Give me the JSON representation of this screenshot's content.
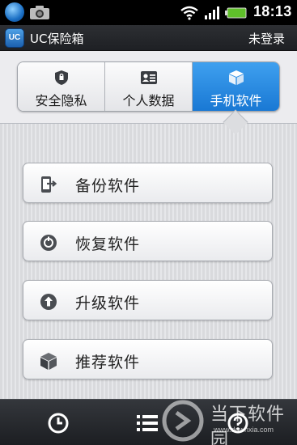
{
  "status_bar": {
    "time": "18:13",
    "icons": [
      "app-badge-icon",
      "camera-icon",
      "wifi-icon",
      "signal-icon",
      "battery-icon"
    ]
  },
  "title_bar": {
    "logo_text": "UC",
    "title": "UC保险箱",
    "login_label": "未登录"
  },
  "tabs": [
    {
      "label": "安全隐私",
      "icon": "shield-icon",
      "active": false
    },
    {
      "label": "个人数据",
      "icon": "contact-card-icon",
      "active": false
    },
    {
      "label": "手机软件",
      "icon": "package-box-icon",
      "active": true
    }
  ],
  "actions": [
    {
      "label": "备份软件",
      "icon": "backup-phone-icon"
    },
    {
      "label": "恢复软件",
      "icon": "restore-circle-icon"
    },
    {
      "label": "升级软件",
      "icon": "upgrade-arrow-icon"
    },
    {
      "label": "推荐软件",
      "icon": "recommend-box-icon"
    }
  ],
  "bottom_nav": [
    {
      "icon": "clock-icon"
    },
    {
      "icon": "list-menu-icon"
    },
    {
      "icon": "help-icon"
    }
  ],
  "watermark": {
    "name": "当下软件园",
    "url": "www.downxia.com"
  },
  "colors": {
    "active_tab": "#2a8ce2",
    "title_bar": "#2a2c30",
    "background": "#dcdde0"
  }
}
